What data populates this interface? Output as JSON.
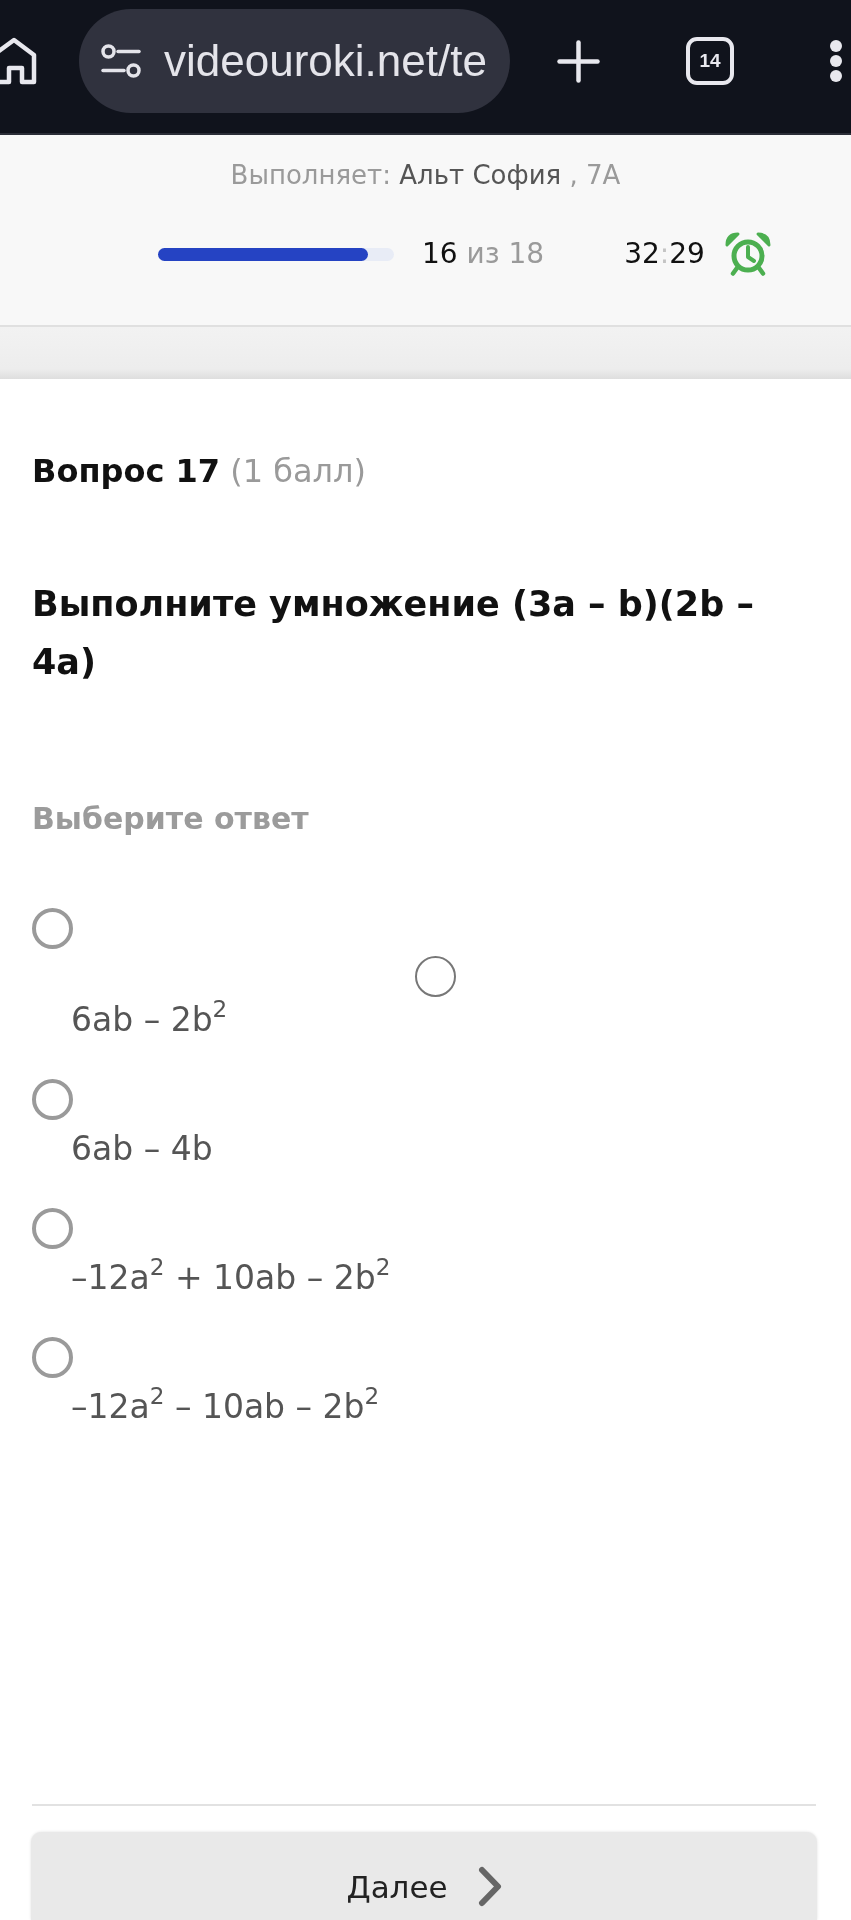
{
  "browser_toolbar": {
    "url": "videouroki.net/te",
    "tab_count": "14"
  },
  "test_header": {
    "performer_label": "Выполняет:",
    "performer_name": "Альт София",
    "performer_class": ", 7А",
    "progress": {
      "level": 0.89,
      "current": "16",
      "total_text": "из 18"
    },
    "timer": {
      "minutes": "32",
      "separator": ":",
      "seconds": "29"
    }
  },
  "question": {
    "title": "Вопрос 17",
    "points": "(1 балл)",
    "text": "Выполните умножение (3a – b)(2b – 4a)"
  },
  "answers": {
    "prompt": "Выберите ответ",
    "extra_radio": {
      "selected": false
    },
    "options": [
      {
        "text": "6ab – 2b$^{2}$",
        "selected": false
      },
      {
        "text": "6ab – 4b",
        "selected": false
      },
      {
        "text": "–12a$^{2}$ + 10ab – 2b$^{2}$",
        "selected": false
      },
      {
        "text": "–12a$^{2}$ – 10ab – 2b$^{2}$",
        "selected": false
      }
    ]
  },
  "footer": {
    "next_button": "Далее"
  }
}
